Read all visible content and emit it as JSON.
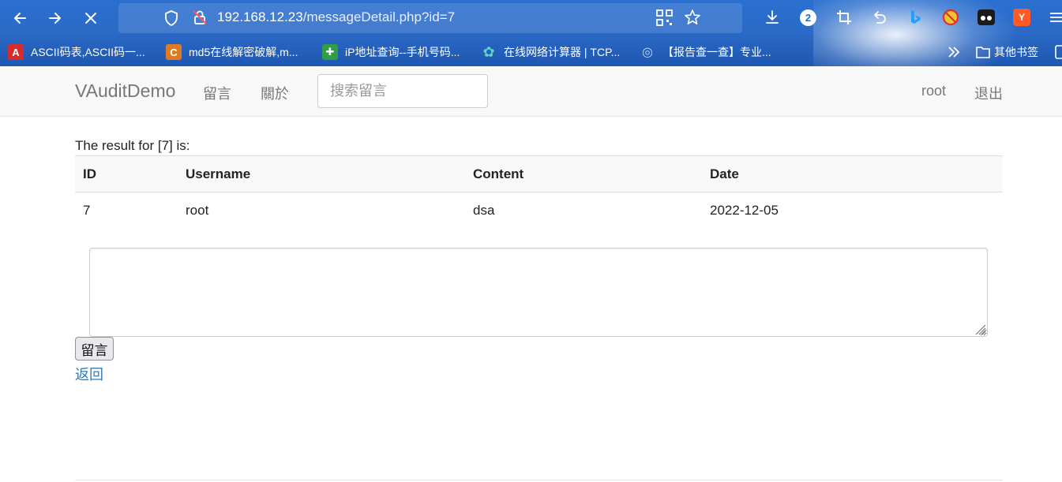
{
  "browser": {
    "url_host": "192.168.12.23",
    "url_path": "/messageDetail.php?id=7",
    "downloads_badge": "2",
    "bookmarks": [
      {
        "label": "ASCII码表,ASCII码一...",
        "color": "#d92b2b",
        "glyph": "A"
      },
      {
        "label": "md5在线解密破解,m...",
        "color": "#e07a20",
        "glyph": "C"
      },
      {
        "label": "iP地址查询--手机号码...",
        "color": "#2f9e44",
        "glyph": "✚"
      },
      {
        "label": "在线网络计算器 | TCP...",
        "color": "#3aa7a0",
        "glyph": "✿"
      },
      {
        "label": "【报告查一查】专业...",
        "color": "#3d7fe0",
        "glyph": "◎"
      }
    ],
    "other_bookmarks": "其他书签"
  },
  "navbar": {
    "brand": "VAuditDemo",
    "links": [
      "留言",
      "關於"
    ],
    "search_placeholder": "搜索留言",
    "user": "root",
    "logout": "退出"
  },
  "content": {
    "result_text": "The result for [7] is:",
    "columns": [
      "ID",
      "Username",
      "Content",
      "Date"
    ],
    "rows": [
      [
        "7",
        "root",
        "dsa",
        "2022-12-05"
      ]
    ],
    "submit_label": "留言",
    "back_link": "返回"
  }
}
